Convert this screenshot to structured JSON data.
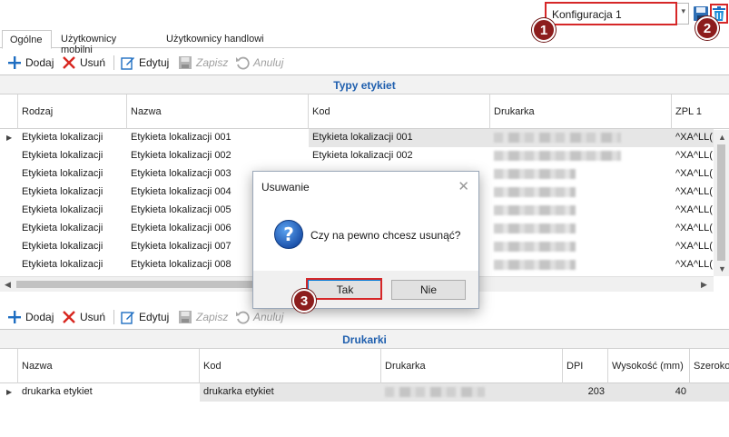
{
  "topbar": {
    "config_value": "Konfiguracja 1",
    "config_arrow": "▾",
    "badge1": "1",
    "badge2": "2",
    "badge3": "3"
  },
  "tabs": [
    "Ogólne",
    "Użytkownicy mobilni",
    "Użytkownicy handlowi"
  ],
  "toolbar": {
    "add": "Dodaj",
    "delete": "Usuń",
    "edit": "Edytuj",
    "save": "Zapisz",
    "cancel": "Anuluj"
  },
  "labels_grid": {
    "title": "Typy etykiet",
    "columns": [
      "Rodzaj",
      "Nazwa",
      "Kod",
      "Drukarka",
      "ZPL 1"
    ],
    "rows": [
      [
        "Etykieta lokalizacji",
        "Etykieta lokalizacji 001",
        "Etykieta lokalizacji 001",
        "",
        "^XA^LL("
      ],
      [
        "Etykieta lokalizacji",
        "Etykieta lokalizacji 002",
        "Etykieta lokalizacji 002",
        "",
        "^XA^LL("
      ],
      [
        "Etykieta lokalizacji",
        "Etykieta lokalizacji 003",
        "",
        "",
        "^XA^LL("
      ],
      [
        "Etykieta lokalizacji",
        "Etykieta lokalizacji 004",
        "",
        "",
        "^XA^LL("
      ],
      [
        "Etykieta lokalizacji",
        "Etykieta lokalizacji 005",
        "",
        "",
        "^XA^LL("
      ],
      [
        "Etykieta lokalizacji",
        "Etykieta lokalizacji 006",
        "",
        "",
        "^XA^LL("
      ],
      [
        "Etykieta lokalizacji",
        "Etykieta lokalizacji 007",
        "",
        "",
        "^XA^LL("
      ],
      [
        "Etykieta lokalizacji",
        "Etykieta lokalizacji 008",
        "",
        "",
        "^XA^LL("
      ]
    ],
    "selected_marker": "▶"
  },
  "printers_grid": {
    "title": "Drukarki",
    "columns": [
      "Nazwa",
      "Kod",
      "Drukarka",
      "DPI",
      "Wysokość (mm)",
      "Szeroko"
    ],
    "rows": [
      [
        "drukarka etykiet",
        "drukarka etykiet",
        "",
        "203",
        "40",
        ""
      ]
    ]
  },
  "dialog": {
    "title": "Usuwanie",
    "close": "✕",
    "message": "Czy na pewno chcesz usunąć?",
    "yes": "Tak",
    "no": "Nie"
  },
  "colors": {
    "accent_blue": "#1f5fae",
    "highlight_red": "#d62728",
    "badge": "#8c1d1d"
  }
}
